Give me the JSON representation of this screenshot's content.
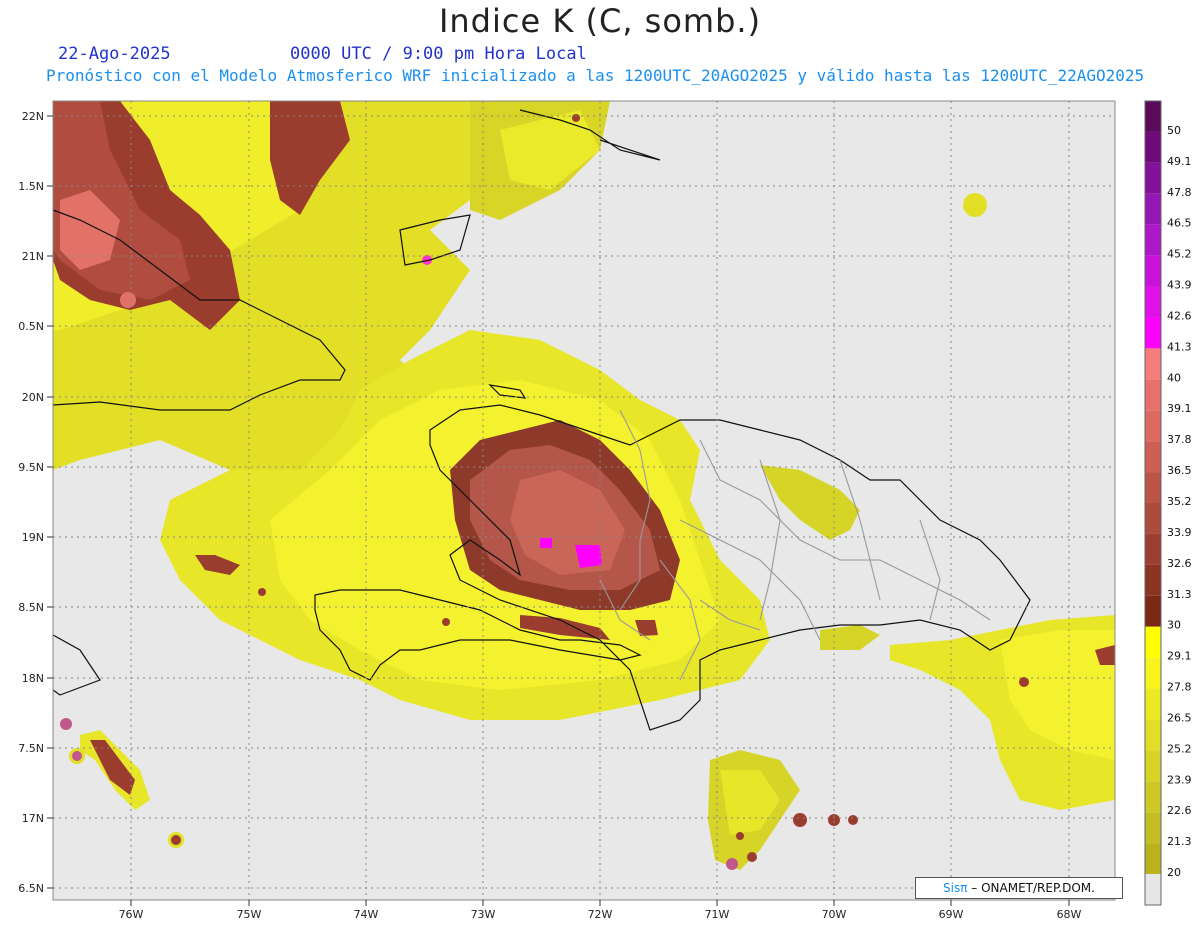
{
  "header": {
    "title": "Indice K (C, somb.)",
    "date": "22-Ago-2025",
    "time": "0000 UTC / 9:00 pm Hora Local",
    "subtitle": "Pronóstico con el Modelo Atmosferico WRF inicializado a las 1200UTC_20AGO2025 y válido hasta las  1200UTC_22AGO2025"
  },
  "axes": {
    "latitudes": [
      "22N",
      "1.5N",
      "21N",
      "0.5N",
      "20N",
      "9.5N",
      "19N",
      "8.5N",
      "18N",
      "7.5N",
      "17N",
      "6.5N"
    ],
    "longitudes": [
      "76W",
      "75W",
      "74W",
      "73W",
      "72W",
      "71W",
      "70W",
      "69W",
      "68W"
    ]
  },
  "colorbar": {
    "levels": [
      {
        "label": "50",
        "color": "#5a0a5a"
      },
      {
        "label": "49.1",
        "color": "#6e0b78"
      },
      {
        "label": "47.8",
        "color": "#82109a"
      },
      {
        "label": "46.5",
        "color": "#9618b4"
      },
      {
        "label": "45.2",
        "color": "#ad18c8"
      },
      {
        "label": "43.9",
        "color": "#c812d8"
      },
      {
        "label": "42.6",
        "color": "#e010e8"
      },
      {
        "label": "41.3",
        "color": "#ff00ff"
      },
      {
        "label": "40",
        "color": "#f47c7c"
      },
      {
        "label": "39.1",
        "color": "#e8706a"
      },
      {
        "label": "37.8",
        "color": "#dc6a60"
      },
      {
        "label": "36.5",
        "color": "#cd5f55"
      },
      {
        "label": "35.2",
        "color": "#bd5448"
      },
      {
        "label": "33.9",
        "color": "#ac4a3c"
      },
      {
        "label": "32.6",
        "color": "#9c3f30"
      },
      {
        "label": "31.3",
        "color": "#8c3422"
      },
      {
        "label": "30",
        "color": "#7a2a14"
      },
      {
        "label": "29.1",
        "color": "#ffff00"
      },
      {
        "label": "27.8",
        "color": "#f6f41c"
      },
      {
        "label": "26.5",
        "color": "#ebea22"
      },
      {
        "label": "25.2",
        "color": "#e0de26"
      },
      {
        "label": "23.9",
        "color": "#d6d426"
      },
      {
        "label": "22.6",
        "color": "#ccc826"
      },
      {
        "label": "21.3",
        "color": "#c2bd22"
      },
      {
        "label": "20",
        "color": "#b8b21c"
      }
    ],
    "below_color": "#e6e6e6"
  },
  "credit": {
    "brand": "Sisπ",
    "org": " – ONAMET/REP.DOM."
  }
}
